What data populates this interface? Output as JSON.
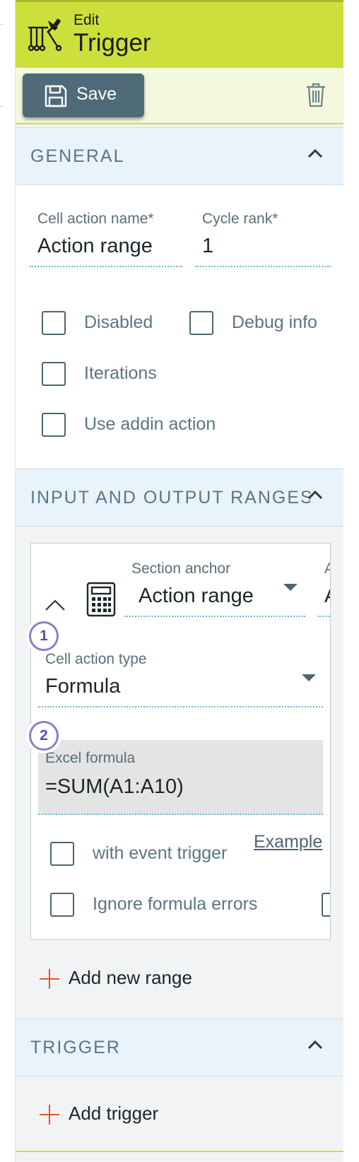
{
  "header": {
    "small": "Edit",
    "title": "Trigger",
    "icon": "trigger-tool-icon",
    "color": "#cddf3a"
  },
  "toolbar": {
    "save_label": "Save",
    "save_icon": "floppy-disk-icon",
    "delete_icon": "trash-icon"
  },
  "general": {
    "title": "GENERAL",
    "cell_action_name": {
      "label": "Cell action name*",
      "value": "Action range"
    },
    "cycle_rank": {
      "label": "Cycle rank*",
      "value": "1"
    },
    "checkboxes": {
      "disabled": {
        "label": "Disabled",
        "checked": false
      },
      "debug_info": {
        "label": "Debug info",
        "checked": false
      },
      "iterations": {
        "label": "Iterations",
        "checked": false
      },
      "use_addin_action": {
        "label": "Use addin action",
        "checked": false
      }
    }
  },
  "ranges": {
    "title": "INPUT AND OUTPUT RANGES",
    "title_visible": "INPUT AND OUTPUT RANGE",
    "card": {
      "section_anchor": {
        "label": "Section anchor",
        "value": "Action range"
      },
      "alias_partial": {
        "label": "Ali",
        "value": "Ac"
      },
      "badges": [
        "1",
        "2"
      ],
      "cell_action_type": {
        "label": "Cell action type",
        "value": "Formula"
      },
      "excel_formula": {
        "label": "Excel formula",
        "value": "=SUM(A1:A10)"
      },
      "with_event_trigger": {
        "label": "with event trigger",
        "checked": false
      },
      "example_link": "Example",
      "ignore_formula_errors": {
        "label": "Ignore formula errors",
        "checked": false
      }
    },
    "add_new_range": "Add new range"
  },
  "trigger": {
    "title": "TRIGGER",
    "add_trigger": "Add trigger"
  },
  "colors": {
    "accent": "#cddf3a",
    "primary_button": "#4f6b78",
    "section_header_bg": "#e9f3fb",
    "add_icon": "#e8532b"
  }
}
